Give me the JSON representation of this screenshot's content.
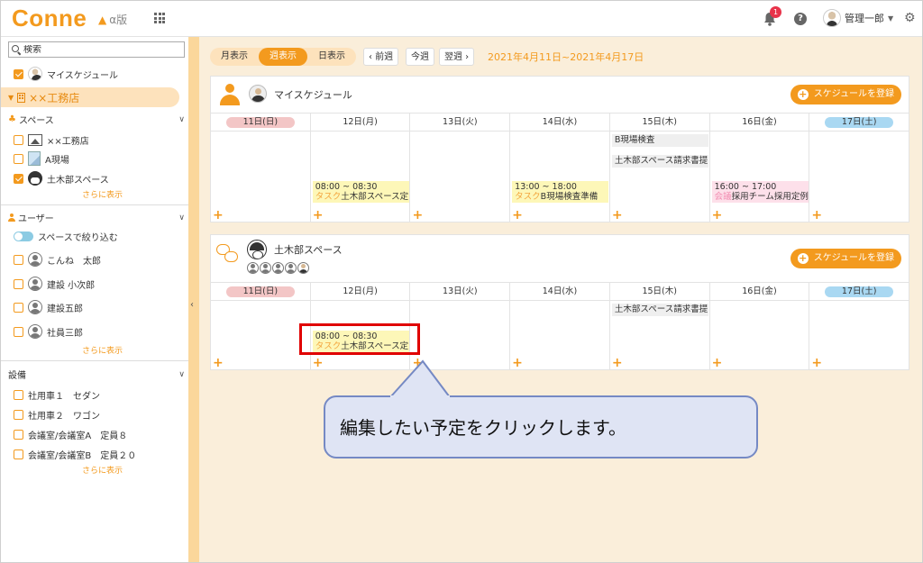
{
  "header": {
    "logo": "Conne",
    "alpha_label": "α版",
    "notification_count": "1",
    "user_name": "管理一郎"
  },
  "sidebar": {
    "search_placeholder": "検索",
    "my_schedule": "マイスケジュール",
    "active_group": "××工務店",
    "spaces": {
      "title": "スペース",
      "items": [
        {
          "label": "××工務店",
          "checked": false
        },
        {
          "label": "A現場",
          "checked": false
        },
        {
          "label": "土木部スペース",
          "checked": true
        }
      ],
      "more": "さらに表示"
    },
    "users": {
      "title": "ユーザー",
      "filter_label": "スペースで絞り込む",
      "items": [
        {
          "label": "こんね　太郎"
        },
        {
          "label": "建設 小次郎"
        },
        {
          "label": "建設五郎"
        },
        {
          "label": "社員三郎"
        }
      ],
      "more": "さらに表示"
    },
    "equipment": {
      "title": "設備",
      "items": [
        {
          "label": "社用車１　セダン"
        },
        {
          "label": "社用車２　ワゴン"
        },
        {
          "label": "会議室/会議室A　定員８"
        },
        {
          "label": "会議室/会議室B　定員２０"
        }
      ],
      "more": "さらに表示"
    }
  },
  "toolbar": {
    "view_tabs": [
      "月表示",
      "週表示",
      "日表示"
    ],
    "active_view": "週表示",
    "prev": "前週",
    "today": "今週",
    "next": "翌週",
    "date_range": "2021年4月11日~2021年4月17日"
  },
  "days": [
    "11日(日)",
    "12日(月)",
    "13日(火)",
    "14日(水)",
    "15日(木)",
    "16日(金)",
    "17日(土)"
  ],
  "calendars": [
    {
      "title": "マイスケジュール",
      "add_label": "スケジュールを登録",
      "events": {
        "mon": {
          "time": "08:00 ~ 08:30",
          "tag": "タスク",
          "title": "土木部スペース定"
        },
        "wed": {
          "time": "13:00 ~ 18:00",
          "tag": "タスク",
          "title": "B現場検査準備"
        },
        "thu1": {
          "title": "B現場検査"
        },
        "thu2": {
          "title": "土木部スペース請求書提"
        },
        "fri": {
          "time": "16:00 ~ 17:00",
          "tag": "会議",
          "title": "採用チーム採用定例"
        }
      }
    },
    {
      "title": "土木部スペース",
      "add_label": "スケジュールを登録",
      "events": {
        "thu": {
          "title": "土木部スペース請求書提"
        },
        "mon": {
          "time": "08:00 ~ 08:30",
          "tag": "タスク",
          "title": "土木部スペース定"
        }
      }
    }
  ],
  "callout": {
    "text": "編集したい予定をクリックします。"
  },
  "colors": {
    "accent": "#f39a1e",
    "highlight": "#e00000",
    "callout_bg": "#dfe4f4"
  }
}
